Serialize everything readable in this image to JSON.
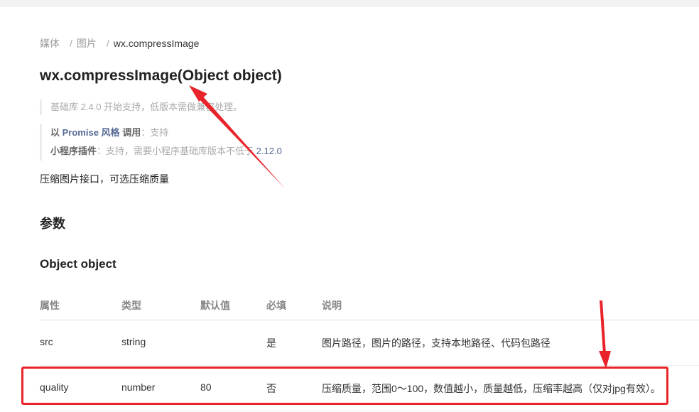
{
  "breadcrumb": {
    "items": [
      "媒体",
      "图片"
    ],
    "current": "wx.compressImage",
    "separator": "/"
  },
  "title": "wx.compressImage(Object object)",
  "notes": {
    "support": "基础库 2.4.0 开始支持，低版本需做兼容处理。",
    "promise_prefix": "以",
    "promise_link": "Promise 风格",
    "promise_label": "调用",
    "promise_value": "：支持",
    "plugin_label": "小程序插件",
    "plugin_text": "：支持，需要小程序基础库版本不低于",
    "plugin_version": "2.12.0"
  },
  "description": "压缩图片接口，可选压缩质量",
  "section_title": "参数",
  "param_title": "Object object",
  "table": {
    "headers": [
      "属性",
      "类型",
      "默认值",
      "必填",
      "说明"
    ],
    "rows": [
      [
        "src",
        "string",
        "",
        "是",
        "图片路径，图片的路径，支持本地路径、代码包路径"
      ],
      [
        "quality",
        "number",
        "80",
        "否",
        "压缩质量，范围0～100，数值越小，质量越低，压缩率越高（仅对jpg有效）。"
      ]
    ]
  },
  "colors": {
    "annotation": "#e8242a",
    "link": "#576b95",
    "muted": "#aaaaaa"
  }
}
